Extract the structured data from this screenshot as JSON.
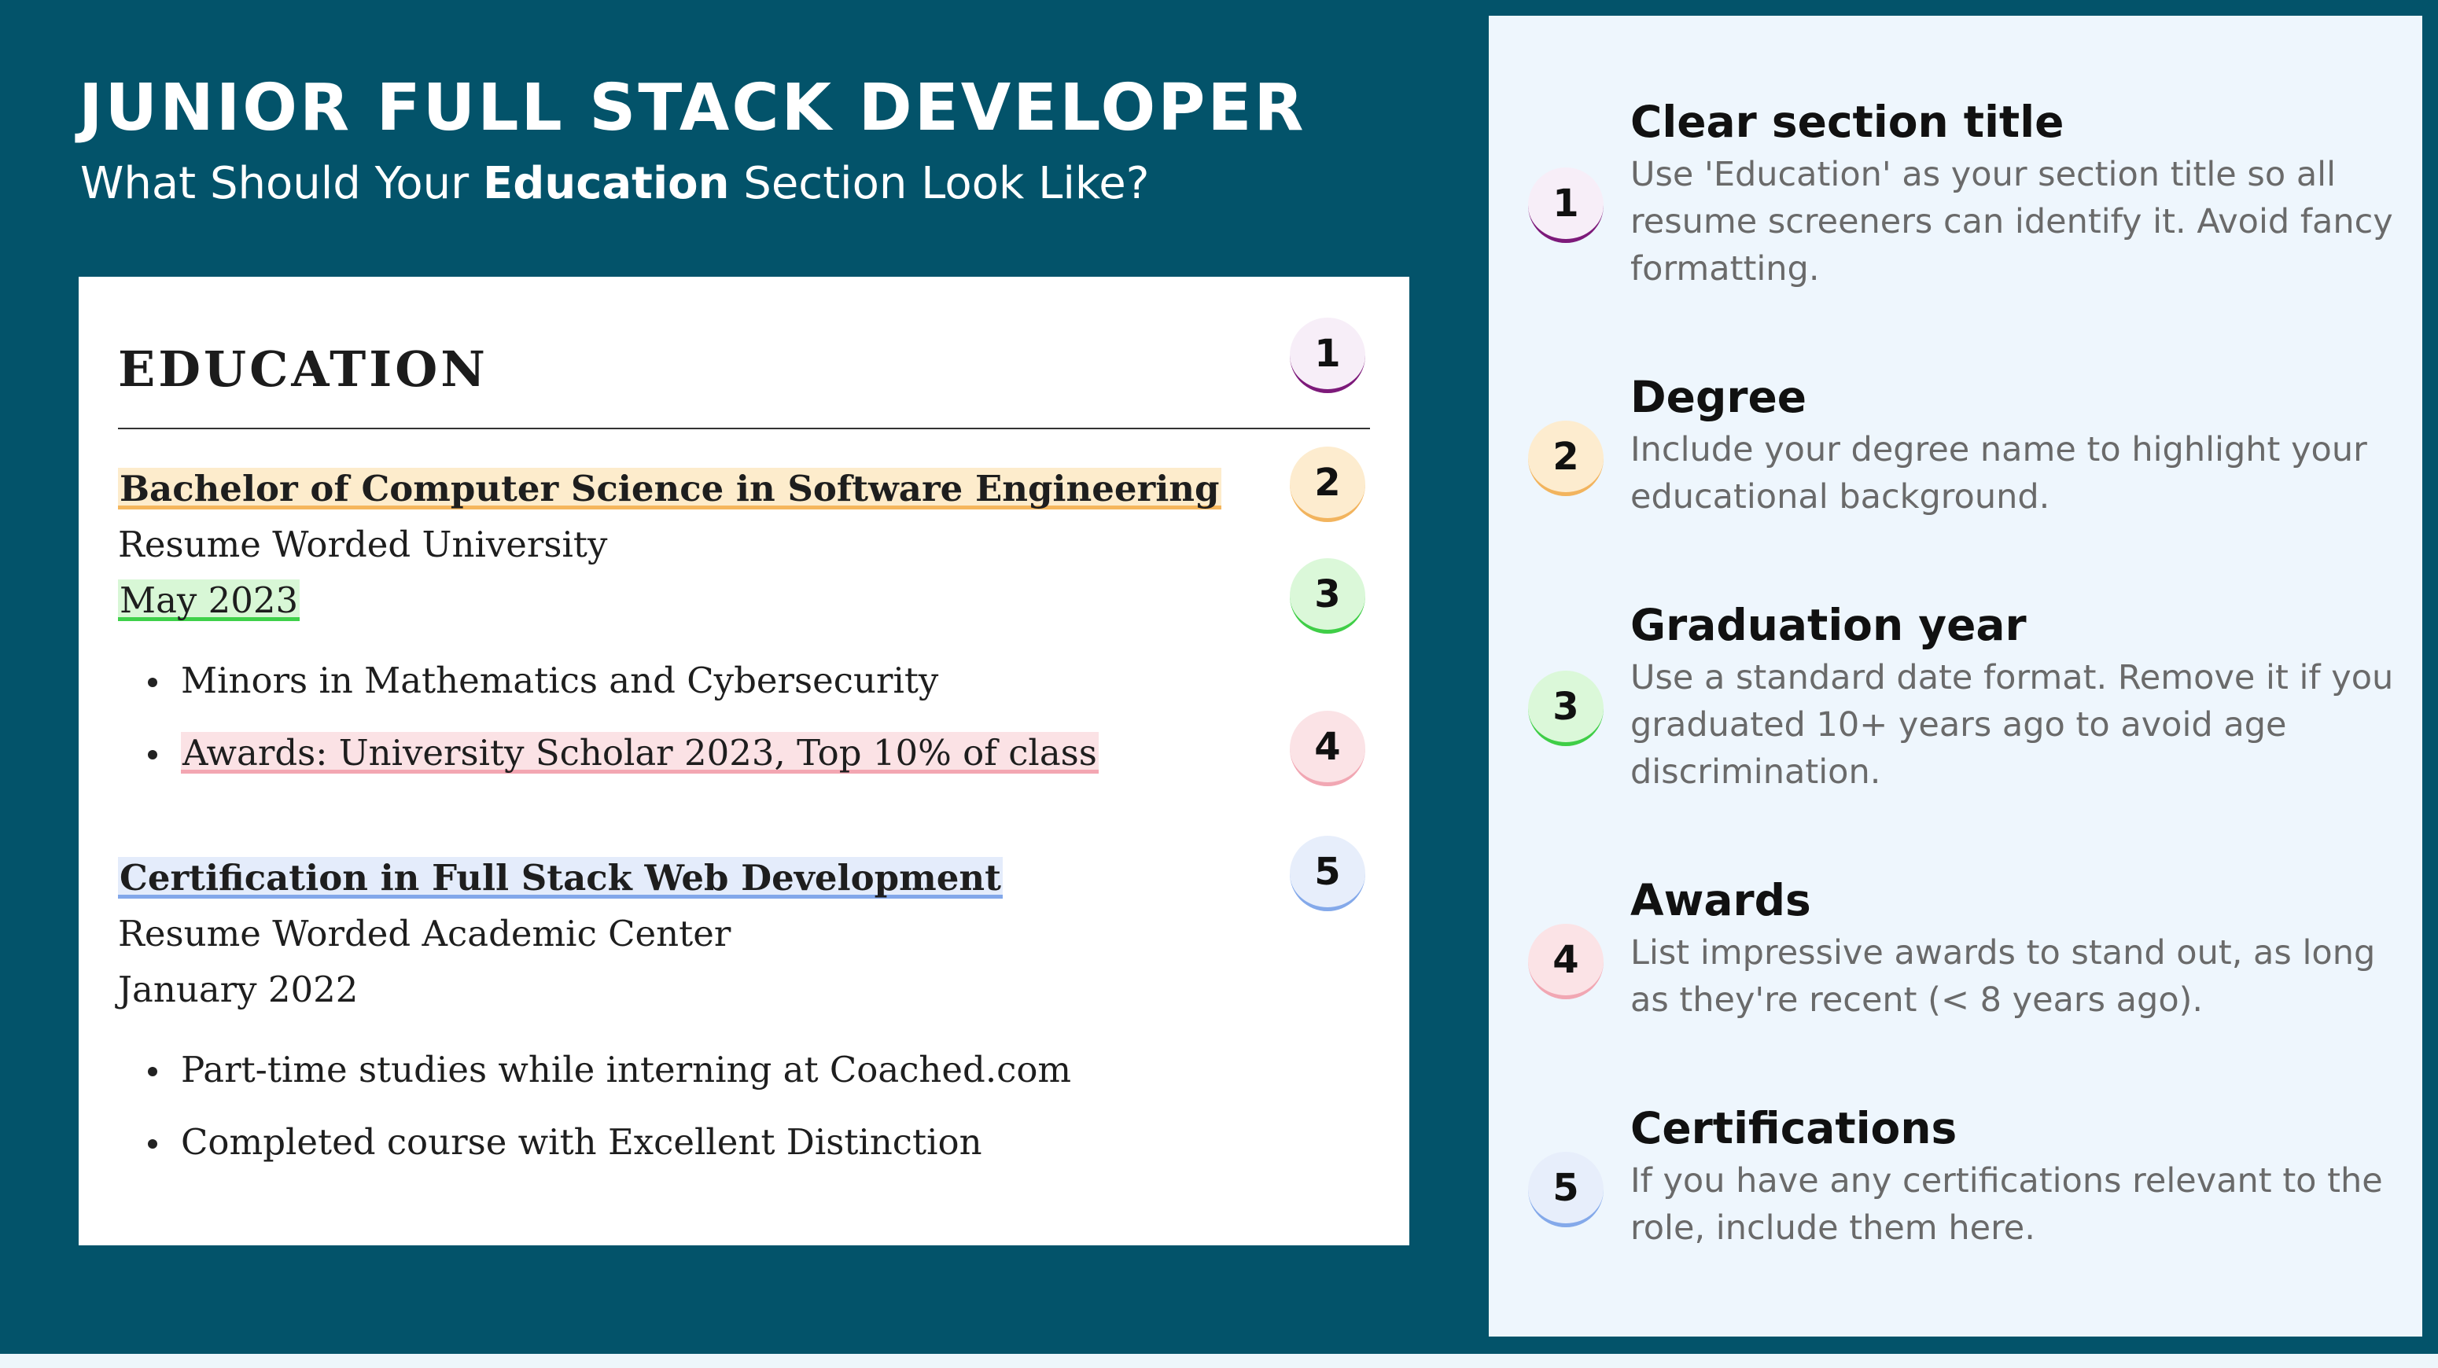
{
  "header": {
    "title": "JUNIOR FULL STACK DEVELOPER",
    "subtitle_prefix": "What Should Your ",
    "subtitle_bold": "Education",
    "subtitle_suffix": " Section Look Like?"
  },
  "resume": {
    "section_title": "EDUCATION",
    "entries": [
      {
        "degree": "Bachelor of Computer Science in Software Engineering",
        "school": "Resume Worded University",
        "date": "May 2023",
        "bullets": [
          "Minors in Mathematics and Cybersecurity",
          "Awards: University Scholar 2023, Top 10% of class"
        ]
      },
      {
        "degree": "Certification in Full Stack Web Development",
        "school": "Resume Worded Academic Center",
        "date": "January 2022",
        "bullets": [
          "Part-time studies while interning at Coached.com",
          "Completed course with Excellent Distinction"
        ]
      }
    ],
    "markers": [
      "1",
      "2",
      "3",
      "4",
      "5"
    ]
  },
  "tips": [
    {
      "number": "1",
      "title": "Clear section title",
      "body": "Use 'Education' as your section title so all resume screeners can identify it. Avoid fancy formatting.",
      "accent": "#7d1a7a"
    },
    {
      "number": "2",
      "title": "Degree",
      "body": "Include your degree name to highlight your educational background.",
      "accent": "#f2b45e"
    },
    {
      "number": "3",
      "title": "Graduation year",
      "body": "Use a standard date format. Remove it if you graduated 10+ years ago to avoid age discrimination.",
      "accent": "#3fce47"
    },
    {
      "number": "4",
      "title": "Awards",
      "body": "List impressive awards to stand out, as long as they're recent (< 8 years ago).",
      "accent": "#f1a7b3"
    },
    {
      "number": "5",
      "title": "Certifications",
      "body": "If you have any certifications relevant to the role, include them here.",
      "accent": "#84a9ea"
    }
  ],
  "colors": {
    "background": "#03536a",
    "panel": "#eef6fd",
    "card": "#ffffff"
  }
}
